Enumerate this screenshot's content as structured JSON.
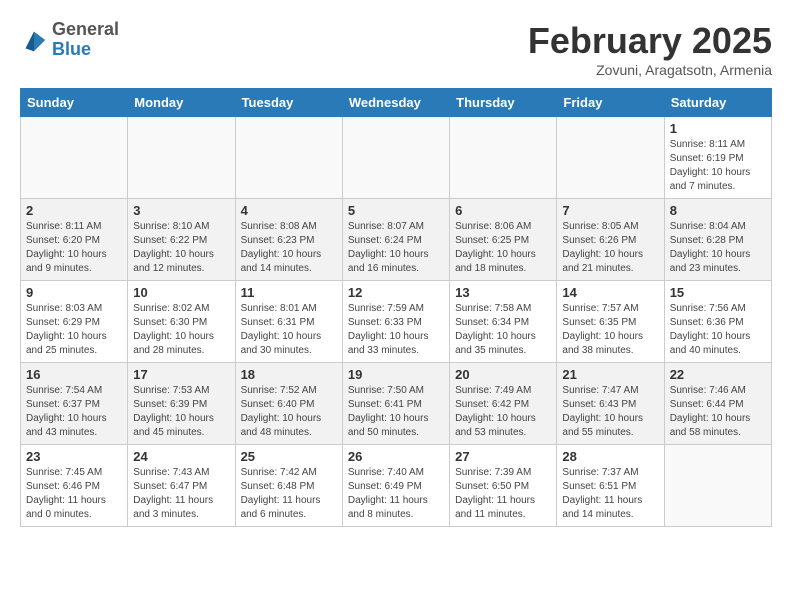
{
  "header": {
    "logo_general": "General",
    "logo_blue": "Blue",
    "month_title": "February 2025",
    "subtitle": "Zovuni, Aragatsotn, Armenia"
  },
  "days_of_week": [
    "Sunday",
    "Monday",
    "Tuesday",
    "Wednesday",
    "Thursday",
    "Friday",
    "Saturday"
  ],
  "weeks": [
    {
      "shade": false,
      "days": [
        {
          "number": "",
          "info": ""
        },
        {
          "number": "",
          "info": ""
        },
        {
          "number": "",
          "info": ""
        },
        {
          "number": "",
          "info": ""
        },
        {
          "number": "",
          "info": ""
        },
        {
          "number": "",
          "info": ""
        },
        {
          "number": "1",
          "info": "Sunrise: 8:11 AM\nSunset: 6:19 PM\nDaylight: 10 hours\nand 7 minutes."
        }
      ]
    },
    {
      "shade": true,
      "days": [
        {
          "number": "2",
          "info": "Sunrise: 8:11 AM\nSunset: 6:20 PM\nDaylight: 10 hours\nand 9 minutes."
        },
        {
          "number": "3",
          "info": "Sunrise: 8:10 AM\nSunset: 6:22 PM\nDaylight: 10 hours\nand 12 minutes."
        },
        {
          "number": "4",
          "info": "Sunrise: 8:08 AM\nSunset: 6:23 PM\nDaylight: 10 hours\nand 14 minutes."
        },
        {
          "number": "5",
          "info": "Sunrise: 8:07 AM\nSunset: 6:24 PM\nDaylight: 10 hours\nand 16 minutes."
        },
        {
          "number": "6",
          "info": "Sunrise: 8:06 AM\nSunset: 6:25 PM\nDaylight: 10 hours\nand 18 minutes."
        },
        {
          "number": "7",
          "info": "Sunrise: 8:05 AM\nSunset: 6:26 PM\nDaylight: 10 hours\nand 21 minutes."
        },
        {
          "number": "8",
          "info": "Sunrise: 8:04 AM\nSunset: 6:28 PM\nDaylight: 10 hours\nand 23 minutes."
        }
      ]
    },
    {
      "shade": false,
      "days": [
        {
          "number": "9",
          "info": "Sunrise: 8:03 AM\nSunset: 6:29 PM\nDaylight: 10 hours\nand 25 minutes."
        },
        {
          "number": "10",
          "info": "Sunrise: 8:02 AM\nSunset: 6:30 PM\nDaylight: 10 hours\nand 28 minutes."
        },
        {
          "number": "11",
          "info": "Sunrise: 8:01 AM\nSunset: 6:31 PM\nDaylight: 10 hours\nand 30 minutes."
        },
        {
          "number": "12",
          "info": "Sunrise: 7:59 AM\nSunset: 6:33 PM\nDaylight: 10 hours\nand 33 minutes."
        },
        {
          "number": "13",
          "info": "Sunrise: 7:58 AM\nSunset: 6:34 PM\nDaylight: 10 hours\nand 35 minutes."
        },
        {
          "number": "14",
          "info": "Sunrise: 7:57 AM\nSunset: 6:35 PM\nDaylight: 10 hours\nand 38 minutes."
        },
        {
          "number": "15",
          "info": "Sunrise: 7:56 AM\nSunset: 6:36 PM\nDaylight: 10 hours\nand 40 minutes."
        }
      ]
    },
    {
      "shade": true,
      "days": [
        {
          "number": "16",
          "info": "Sunrise: 7:54 AM\nSunset: 6:37 PM\nDaylight: 10 hours\nand 43 minutes."
        },
        {
          "number": "17",
          "info": "Sunrise: 7:53 AM\nSunset: 6:39 PM\nDaylight: 10 hours\nand 45 minutes."
        },
        {
          "number": "18",
          "info": "Sunrise: 7:52 AM\nSunset: 6:40 PM\nDaylight: 10 hours\nand 48 minutes."
        },
        {
          "number": "19",
          "info": "Sunrise: 7:50 AM\nSunset: 6:41 PM\nDaylight: 10 hours\nand 50 minutes."
        },
        {
          "number": "20",
          "info": "Sunrise: 7:49 AM\nSunset: 6:42 PM\nDaylight: 10 hours\nand 53 minutes."
        },
        {
          "number": "21",
          "info": "Sunrise: 7:47 AM\nSunset: 6:43 PM\nDaylight: 10 hours\nand 55 minutes."
        },
        {
          "number": "22",
          "info": "Sunrise: 7:46 AM\nSunset: 6:44 PM\nDaylight: 10 hours\nand 58 minutes."
        }
      ]
    },
    {
      "shade": false,
      "days": [
        {
          "number": "23",
          "info": "Sunrise: 7:45 AM\nSunset: 6:46 PM\nDaylight: 11 hours\nand 0 minutes."
        },
        {
          "number": "24",
          "info": "Sunrise: 7:43 AM\nSunset: 6:47 PM\nDaylight: 11 hours\nand 3 minutes."
        },
        {
          "number": "25",
          "info": "Sunrise: 7:42 AM\nSunset: 6:48 PM\nDaylight: 11 hours\nand 6 minutes."
        },
        {
          "number": "26",
          "info": "Sunrise: 7:40 AM\nSunset: 6:49 PM\nDaylight: 11 hours\nand 8 minutes."
        },
        {
          "number": "27",
          "info": "Sunrise: 7:39 AM\nSunset: 6:50 PM\nDaylight: 11 hours\nand 11 minutes."
        },
        {
          "number": "28",
          "info": "Sunrise: 7:37 AM\nSunset: 6:51 PM\nDaylight: 11 hours\nand 14 minutes."
        },
        {
          "number": "",
          "info": ""
        }
      ]
    }
  ]
}
